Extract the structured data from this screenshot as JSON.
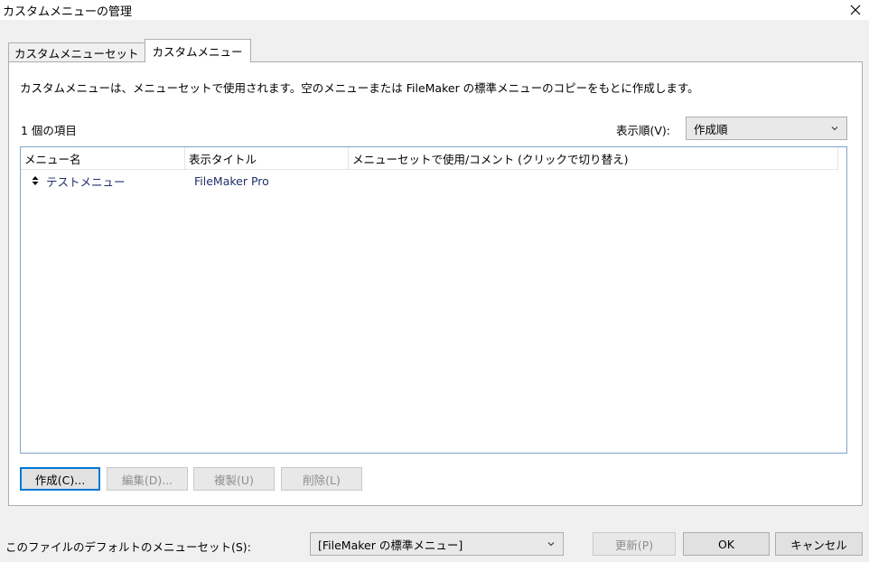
{
  "window": {
    "title": "カスタムメニューの管理"
  },
  "tabs": [
    {
      "label": "カスタムメニューセット",
      "active": false
    },
    {
      "label": "カスタムメニュー",
      "active": true
    }
  ],
  "panel": {
    "description": "カスタムメニューは、メニューセットで使用されます。空のメニューまたは FileMaker の標準メニューのコピーをもとに作成します。",
    "item_count": "1 個の項目",
    "sort_label": "表示順(V):",
    "sort_value": "作成順"
  },
  "list": {
    "columns": [
      "メニュー名",
      "表示タイトル",
      "メニューセットで使用/コメント (クリックで切り替え)"
    ],
    "rows": [
      {
        "name": "テストメニュー",
        "title": "FileMaker Pro",
        "comment": ""
      }
    ]
  },
  "actions": {
    "create": "作成(C)...",
    "edit": "編集(D)...",
    "duplicate": "複製(U)",
    "delete": "削除(L)"
  },
  "footer": {
    "default_menuset_label": "このファイルのデフォルトのメニューセット(S):",
    "default_menuset_value": "[FileMaker の標準メニュー]",
    "update": "更新(P)",
    "ok": "OK",
    "cancel": "キャンセル"
  },
  "icons": {
    "close": "close-icon",
    "dropdown": "chevron-down-icon",
    "move": "move-handle-icon"
  }
}
